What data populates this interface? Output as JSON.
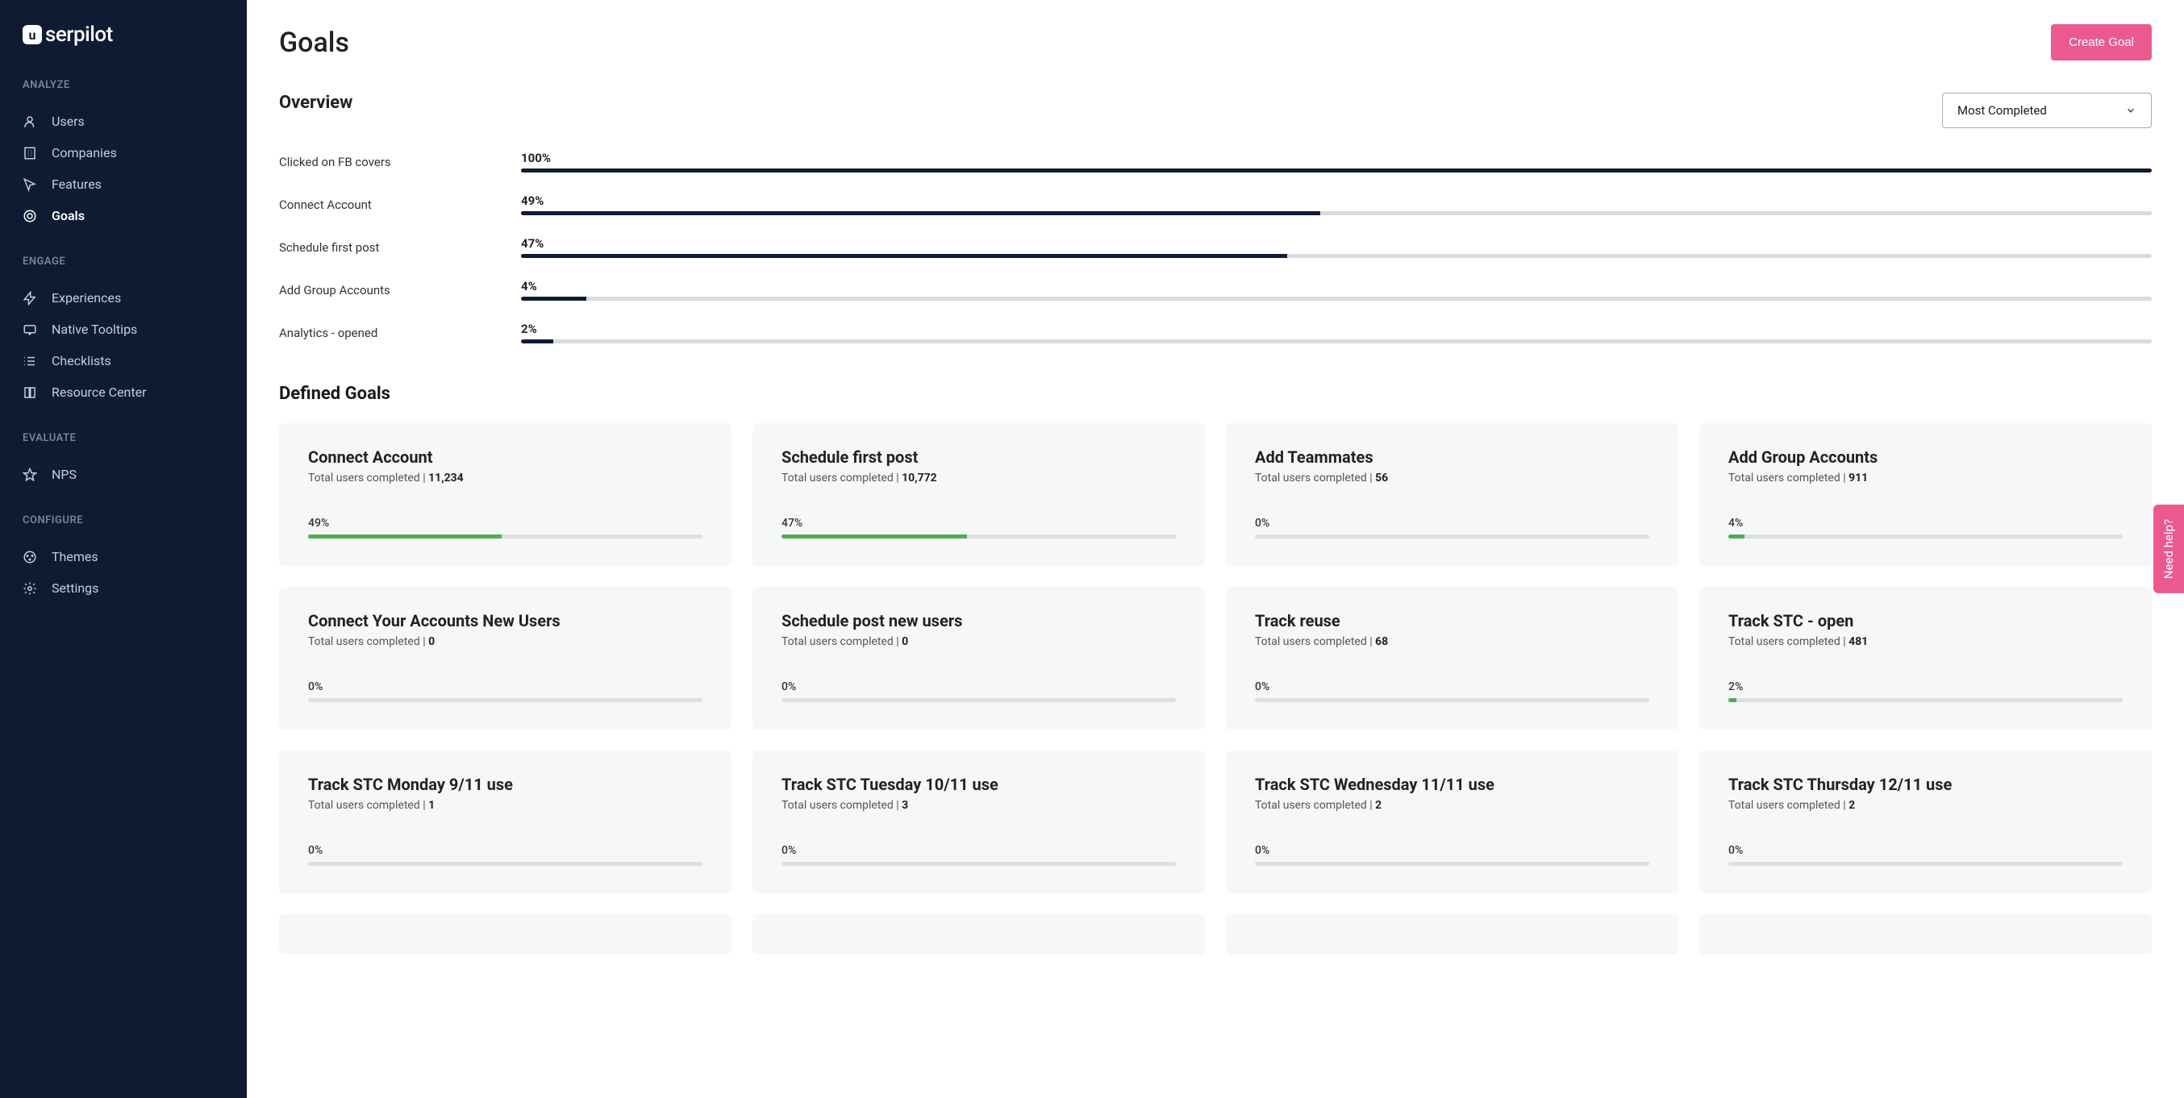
{
  "brand": "serpilot",
  "page_title": "Goals",
  "create_goal_label": "Create Goal",
  "overview_heading": "Overview",
  "sort_label": "Most Completed",
  "defined_heading": "Defined Goals",
  "help_label": "Need help?",
  "total_users_prefix": "Total users completed | ",
  "nav": {
    "analyze": {
      "heading": "ANALYZE",
      "users": "Users",
      "companies": "Companies",
      "features": "Features",
      "goals": "Goals"
    },
    "engage": {
      "heading": "ENGAGE",
      "experiences": "Experiences",
      "tooltips": "Native Tooltips",
      "checklists": "Checklists",
      "rc": "Resource Center"
    },
    "evaluate": {
      "heading": "EVALUATE",
      "nps": "NPS"
    },
    "configure": {
      "heading": "CONFIGURE",
      "themes": "Themes",
      "settings": "Settings"
    }
  },
  "overview": [
    {
      "label": "Clicked on FB covers",
      "pct": "100%",
      "w": 100
    },
    {
      "label": "Connect Account",
      "pct": "49%",
      "w": 49
    },
    {
      "label": "Schedule first post",
      "pct": "47%",
      "w": 47
    },
    {
      "label": "Add Group Accounts",
      "pct": "4%",
      "w": 4
    },
    {
      "label": "Analytics - opened",
      "pct": "2%",
      "w": 2
    }
  ],
  "cards": [
    {
      "title": "Connect Account",
      "count": "11,234",
      "pct": "49%",
      "w": 49
    },
    {
      "title": "Schedule first post",
      "count": "10,772",
      "pct": "47%",
      "w": 47
    },
    {
      "title": "Add Teammates",
      "count": "56",
      "pct": "0%",
      "w": 0
    },
    {
      "title": "Add Group Accounts",
      "count": "911",
      "pct": "4%",
      "w": 4
    },
    {
      "title": "Connect Your Accounts New Users",
      "count": "0",
      "pct": "0%",
      "w": 0
    },
    {
      "title": "Schedule post new users",
      "count": "0",
      "pct": "0%",
      "w": 0
    },
    {
      "title": "Track reuse",
      "count": "68",
      "pct": "0%",
      "w": 0
    },
    {
      "title": "Track STC - open",
      "count": "481",
      "pct": "2%",
      "w": 2
    },
    {
      "title": "Track STC Monday 9/11 use",
      "count": "1",
      "pct": "0%",
      "w": 0
    },
    {
      "title": "Track STC Tuesday 10/11 use",
      "count": "3",
      "pct": "0%",
      "w": 0
    },
    {
      "title": "Track STC Wednesday 11/11 use",
      "count": "2",
      "pct": "0%",
      "w": 0
    },
    {
      "title": "Track STC Thursday 12/11 use",
      "count": "2",
      "pct": "0%",
      "w": 0
    }
  ]
}
